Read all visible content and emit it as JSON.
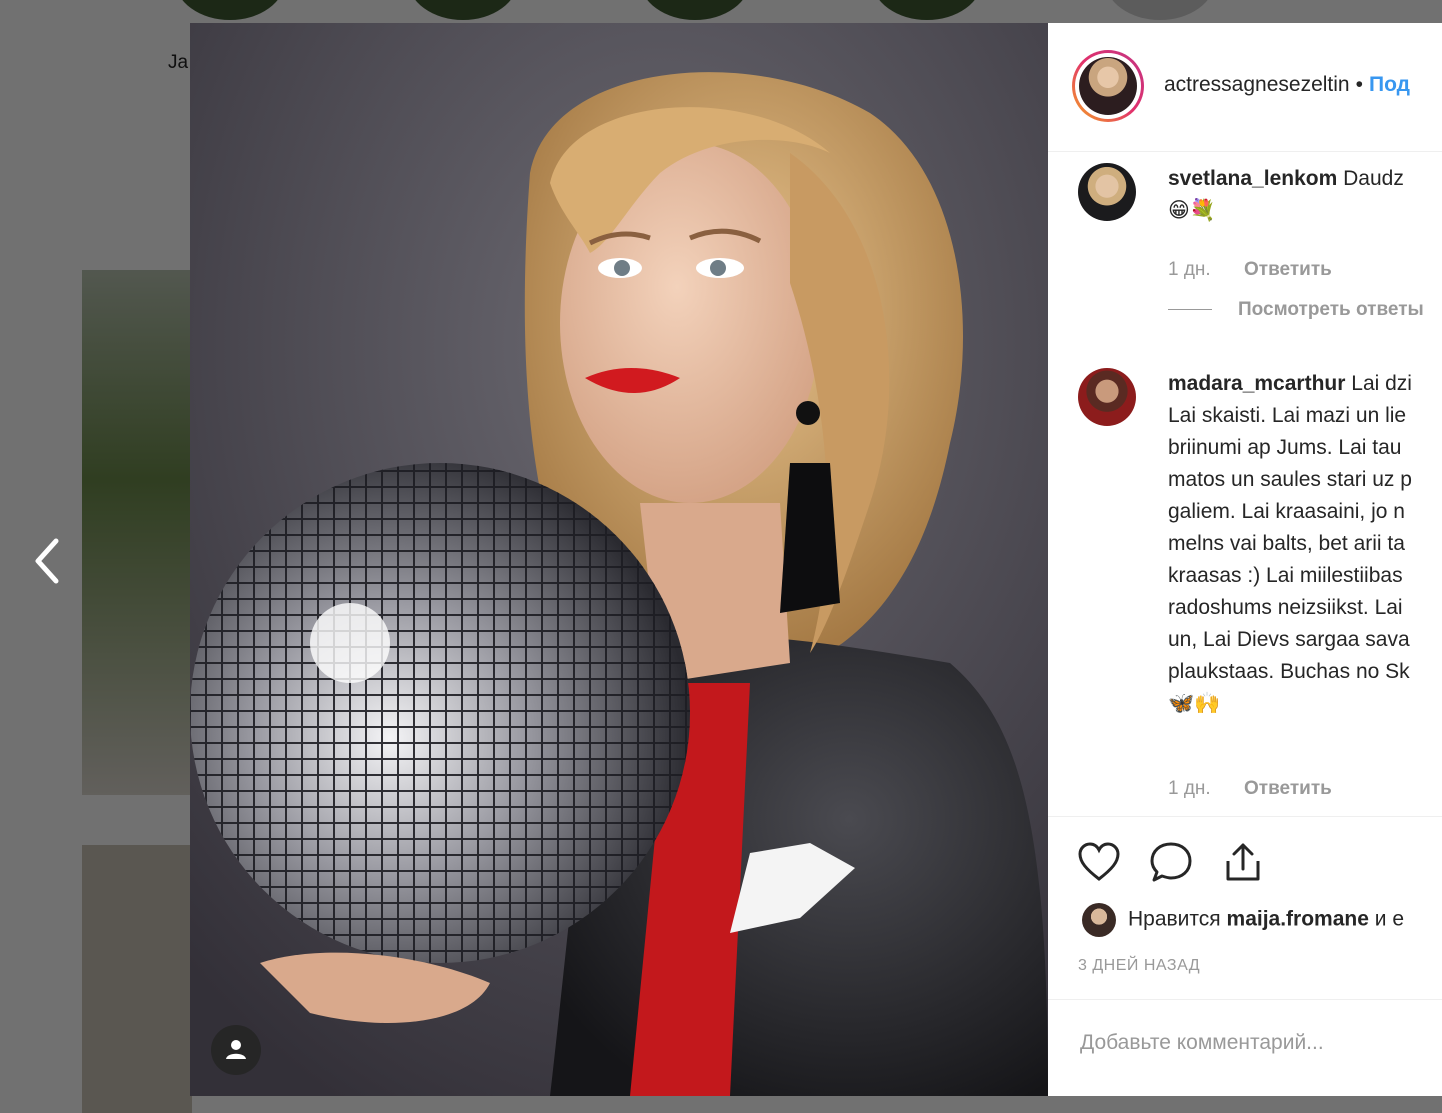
{
  "background": {
    "partial_name": "Ja"
  },
  "post": {
    "username": "actressagnesezeltin",
    "separator": "•",
    "follow_label": "Под"
  },
  "comments": [
    {
      "username": "svetlana_lenkom",
      "lines": [
        "Daudz",
        "😁💐"
      ],
      "time": "1 дн.",
      "reply_label": "Ответить",
      "view_replies": "Посмотреть ответы"
    },
    {
      "username": "madara_mcarthur",
      "lines": [
        "Lai dzi",
        "Lai skaisti. Lai mazi un lie",
        "briinumi ap Jums. Lai tau",
        "matos un saules stari uz p",
        "galiem. Lai kraasaini, jo n",
        "melns vai balts, bet arii ta",
        "kraasas :) Lai miilestiibas",
        "radoshums neizsiikst. Lai",
        "un, Lai Dievs sargaa sava",
        "plaukstaas. Buchas no Sk",
        "🦋🙌"
      ],
      "time": "1 дн.",
      "reply_label": "Ответить"
    }
  ],
  "likes": {
    "prefix": "Нравится",
    "user": "maija.fromane",
    "suffix": "и е"
  },
  "posted_time": "3 ДНЕЙ НАЗАД",
  "comment_input": {
    "placeholder": "Добавьте комментарий..."
  },
  "icons": [
    "chevron-left-icon",
    "heart-icon",
    "comment-icon",
    "share-icon",
    "user-tag-icon"
  ]
}
